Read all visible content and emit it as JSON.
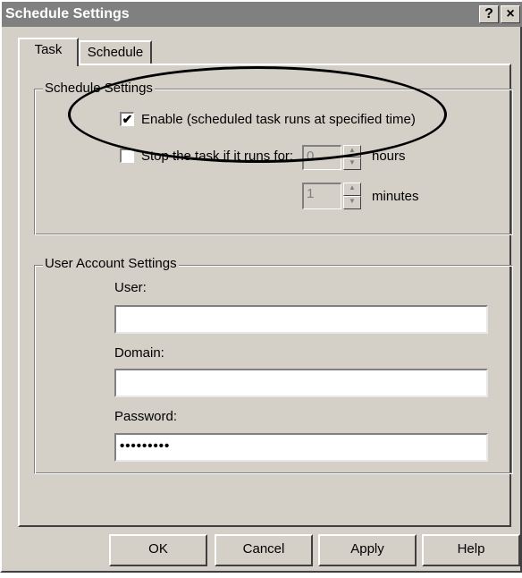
{
  "window": {
    "title": "Schedule Settings",
    "help_button": "?",
    "close_button": "×"
  },
  "tabs": [
    {
      "label": "Task",
      "active": true
    },
    {
      "label": "Schedule",
      "active": false
    }
  ],
  "schedule_settings": {
    "group_label": "Schedule Settings",
    "enable": {
      "label": "Enable (scheduled task runs at specified time)",
      "checked": true,
      "mark": "✔"
    },
    "stop_task": {
      "label": "Stop the task if it runs for:",
      "checked": false
    },
    "hours": {
      "value": "0",
      "unit": "hours"
    },
    "minutes": {
      "value": "1",
      "unit": "minutes"
    }
  },
  "user_account": {
    "group_label": "User Account Settings",
    "user": {
      "label": "User:",
      "value": ""
    },
    "domain": {
      "label": "Domain:",
      "value": ""
    },
    "password": {
      "label": "Password:",
      "value": "•••••••••"
    }
  },
  "buttons": {
    "ok": "OK",
    "cancel": "Cancel",
    "apply": "Apply",
    "help": "Help"
  }
}
